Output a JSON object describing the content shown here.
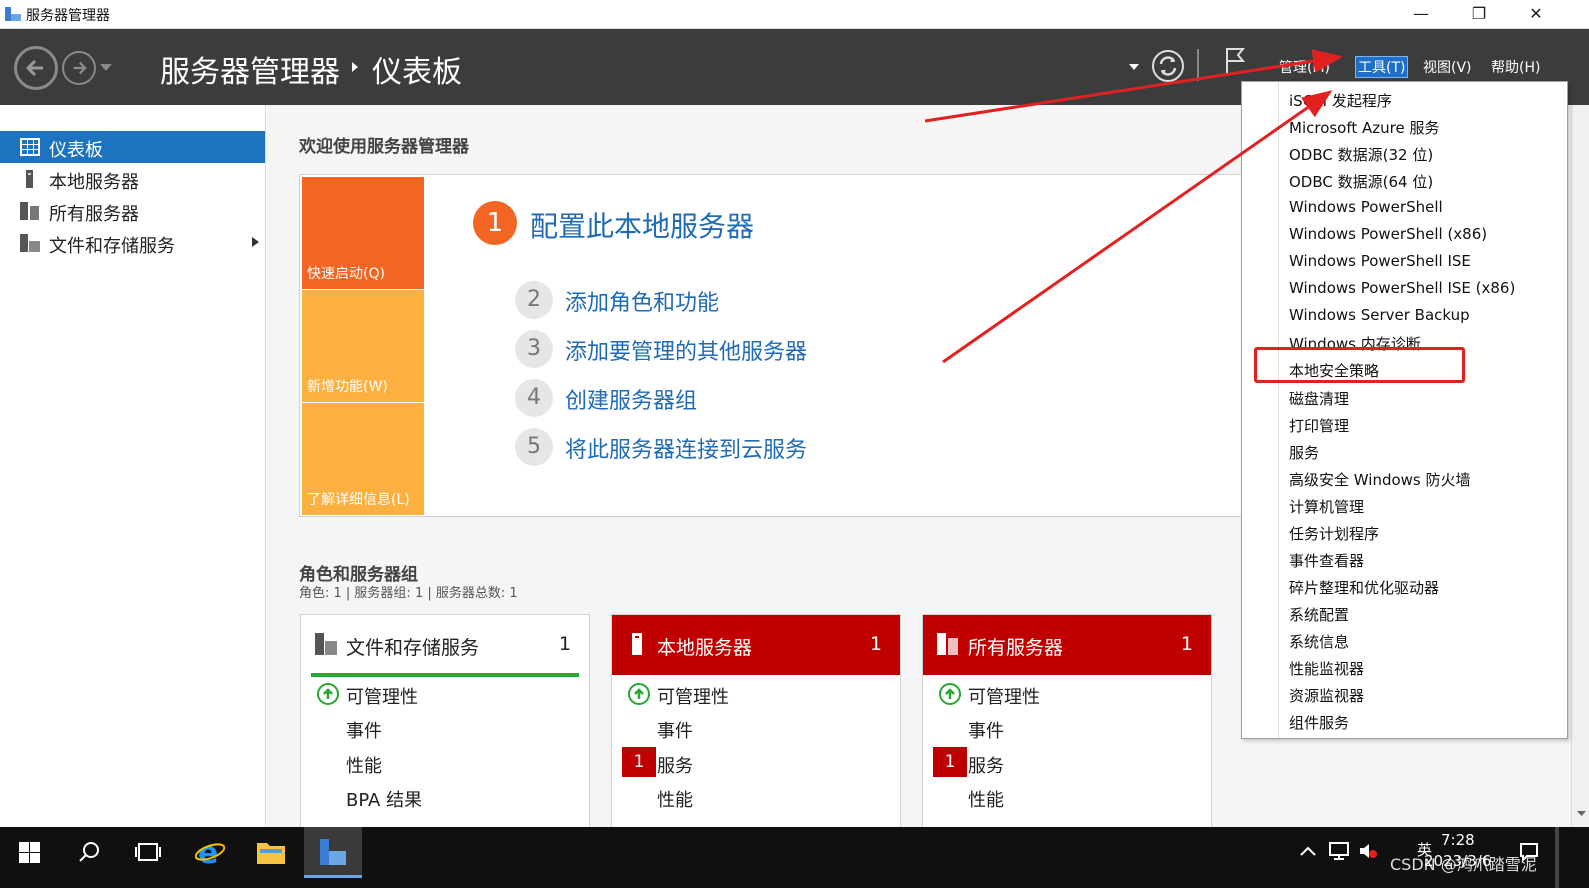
{
  "window": {
    "title": "服务器管理器",
    "minimize": "—",
    "restore": "❐",
    "close": "✕"
  },
  "header": {
    "breadcrumb_root": "服务器管理器",
    "breadcrumb_page": "仪表板",
    "menus": {
      "manage": "管理(M)",
      "tools": "工具(T)",
      "view": "视图(V)",
      "help": "帮助(H)"
    }
  },
  "sidebar": {
    "items": [
      {
        "label": "仪表板",
        "icon": "dashboard-icon"
      },
      {
        "label": "本地服务器",
        "icon": "server-icon"
      },
      {
        "label": "所有服务器",
        "icon": "servers-icon"
      },
      {
        "label": "文件和存储服务",
        "icon": "storage-icon"
      }
    ]
  },
  "welcome": {
    "title": "欢迎使用服务器管理器",
    "tiles": [
      "快速启动(Q)",
      "新增功能(W)",
      "了解详细信息(L)"
    ],
    "steps": [
      {
        "num": "1",
        "label": "配置此本地服务器"
      },
      {
        "num": "2",
        "label": "添加角色和功能"
      },
      {
        "num": "3",
        "label": "添加要管理的其他服务器"
      },
      {
        "num": "4",
        "label": "创建服务器组"
      },
      {
        "num": "5",
        "label": "将此服务器连接到云服务"
      }
    ]
  },
  "roles": {
    "title": "角色和服务器组",
    "subtitle": "角色: 1 | 服务器组: 1 | 服务器总数: 1",
    "cards": [
      {
        "name": "文件和存储服务",
        "count": "1",
        "rows": [
          "可管理性",
          "事件",
          "性能",
          "BPA 结果"
        ]
      },
      {
        "name": "本地服务器",
        "count": "1",
        "rows": [
          "可管理性",
          "事件",
          "服务",
          "性能"
        ],
        "services_badge": "1"
      },
      {
        "name": "所有服务器",
        "count": "1",
        "rows": [
          "可管理性",
          "事件",
          "服务",
          "性能"
        ],
        "services_badge": "1"
      }
    ]
  },
  "tools_menu": {
    "items": [
      "iSCSI 发起程序",
      "Microsoft Azure 服务",
      "ODBC 数据源(32 位)",
      "ODBC 数据源(64 位)",
      "Windows PowerShell",
      "Windows PowerShell (x86)",
      "Windows PowerShell ISE",
      "Windows PowerShell ISE (x86)",
      "Windows Server Backup",
      "Windows 内存诊断",
      "本地安全策略",
      "磁盘清理",
      "打印管理",
      "服务",
      "高级安全 Windows 防火墙",
      "计算机管理",
      "任务计划程序",
      "事件查看器",
      "碎片整理和优化驱动器",
      "系统配置",
      "系统信息",
      "性能监视器",
      "资源监视器",
      "组件服务"
    ],
    "highlighted": "本地安全策略"
  },
  "taskbar": {
    "time": "7:28",
    "date": "2023/3/6",
    "ime": "英",
    "watermark": "CSDN @鸿爪踏雪泥"
  },
  "colors": {
    "accent": "#1e73be",
    "header": "#3c3c3c",
    "quick_start": "#f26522",
    "tile_light": "#fbb040",
    "alert_red": "#c00000",
    "ok_green": "#27a830",
    "annotation": "#e32020"
  }
}
